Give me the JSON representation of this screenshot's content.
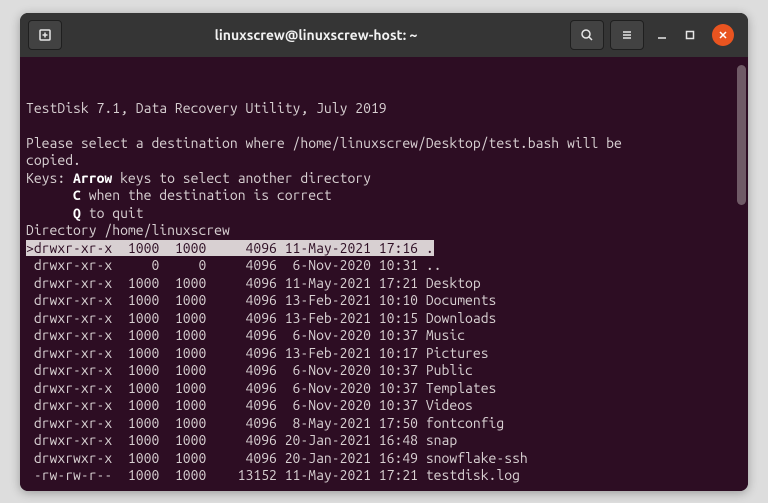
{
  "window": {
    "title": "linuxscrew@linuxscrew-host: ~"
  },
  "app": {
    "header": "TestDisk 7.1, Data Recovery Utility, July 2019",
    "instruction_l1": "Please select a destination where /home/linuxscrew/Desktop/test.bash will be",
    "instruction_l2": "copied.",
    "keys_label": "Keys:",
    "keys_arrow_bold": "Arrow",
    "keys_arrow_rest": " keys to select another directory",
    "keys_c_bold": "C",
    "keys_c_rest": " when the destination is correct",
    "keys_q_bold": "Q",
    "keys_q_rest": " to quit",
    "directory_label": "Directory /home/linuxscrew"
  },
  "listing": [
    {
      "perm": "drwxr-xr-x",
      "uid": "1000",
      "gid": "1000",
      "size": "4096",
      "date": "11-May-2021 17:16",
      "name": ".",
      "selected": true
    },
    {
      "perm": "drwxr-xr-x",
      "uid": "0",
      "gid": "0",
      "size": "4096",
      "date": " 6-Nov-2020 10:31",
      "name": "..",
      "selected": false
    },
    {
      "perm": "drwxr-xr-x",
      "uid": "1000",
      "gid": "1000",
      "size": "4096",
      "date": "11-May-2021 17:21",
      "name": "Desktop",
      "selected": false
    },
    {
      "perm": "drwxr-xr-x",
      "uid": "1000",
      "gid": "1000",
      "size": "4096",
      "date": "13-Feb-2021 10:10",
      "name": "Documents",
      "selected": false
    },
    {
      "perm": "drwxr-xr-x",
      "uid": "1000",
      "gid": "1000",
      "size": "4096",
      "date": "13-Feb-2021 10:15",
      "name": "Downloads",
      "selected": false
    },
    {
      "perm": "drwxr-xr-x",
      "uid": "1000",
      "gid": "1000",
      "size": "4096",
      "date": " 6-Nov-2020 10:37",
      "name": "Music",
      "selected": false
    },
    {
      "perm": "drwxr-xr-x",
      "uid": "1000",
      "gid": "1000",
      "size": "4096",
      "date": "13-Feb-2021 10:17",
      "name": "Pictures",
      "selected": false
    },
    {
      "perm": "drwxr-xr-x",
      "uid": "1000",
      "gid": "1000",
      "size": "4096",
      "date": " 6-Nov-2020 10:37",
      "name": "Public",
      "selected": false
    },
    {
      "perm": "drwxr-xr-x",
      "uid": "1000",
      "gid": "1000",
      "size": "4096",
      "date": " 6-Nov-2020 10:37",
      "name": "Templates",
      "selected": false
    },
    {
      "perm": "drwxr-xr-x",
      "uid": "1000",
      "gid": "1000",
      "size": "4096",
      "date": " 6-Nov-2020 10:37",
      "name": "Videos",
      "selected": false
    },
    {
      "perm": "drwxr-xr-x",
      "uid": "1000",
      "gid": "1000",
      "size": "4096",
      "date": " 8-May-2021 17:50",
      "name": "fontconfig",
      "selected": false
    },
    {
      "perm": "drwxr-xr-x",
      "uid": "1000",
      "gid": "1000",
      "size": "4096",
      "date": "20-Jan-2021 16:48",
      "name": "snap",
      "selected": false
    },
    {
      "perm": "drwxrwxr-x",
      "uid": "1000",
      "gid": "1000",
      "size": "4096",
      "date": "20-Jan-2021 16:49",
      "name": "snowflake-ssh",
      "selected": false
    },
    {
      "perm": "-rw-rw-r--",
      "uid": "1000",
      "gid": "1000",
      "size": "13152",
      "date": "11-May-2021 17:21",
      "name": "testdisk.log",
      "selected": false
    }
  ]
}
